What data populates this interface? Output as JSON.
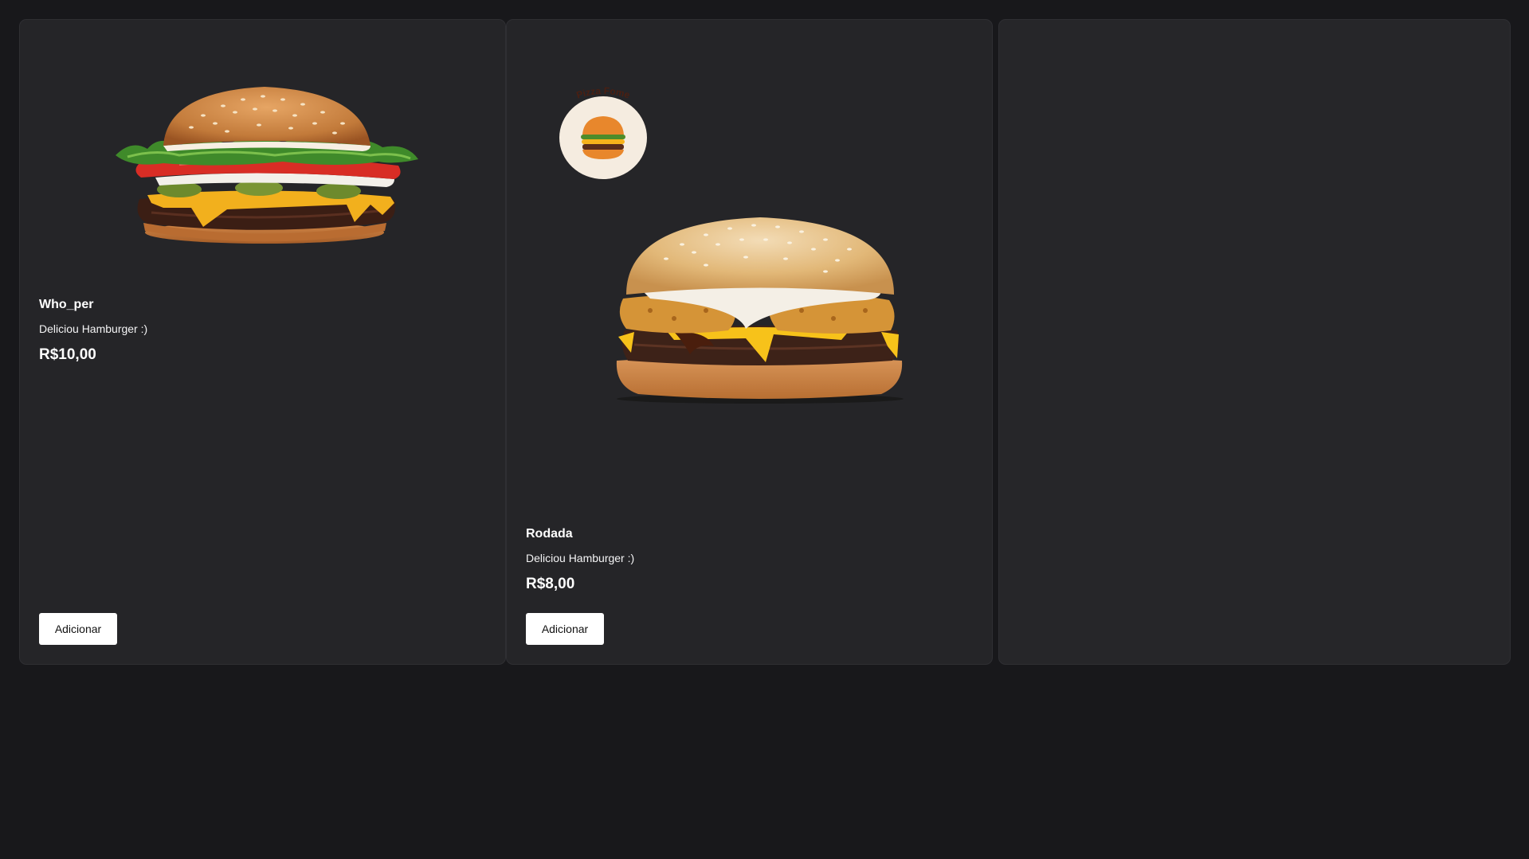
{
  "products": [
    {
      "name": "Who_per",
      "description": "Deliciou Hamburger :)",
      "price": "R$10,00",
      "button_label": "Adicionar"
    },
    {
      "name": "Rodada",
      "description": "Deliciou Hamburger :)",
      "price": "R$8,00",
      "button_label": "Adicionar"
    }
  ],
  "logo": {
    "text": "Pizza Fome"
  },
  "colors": {
    "page_background": "#18181b",
    "card_background": "#252528",
    "button_background": "#ffffff",
    "logo_badge": "#f5ece0",
    "logo_text": "#4a1f12"
  }
}
